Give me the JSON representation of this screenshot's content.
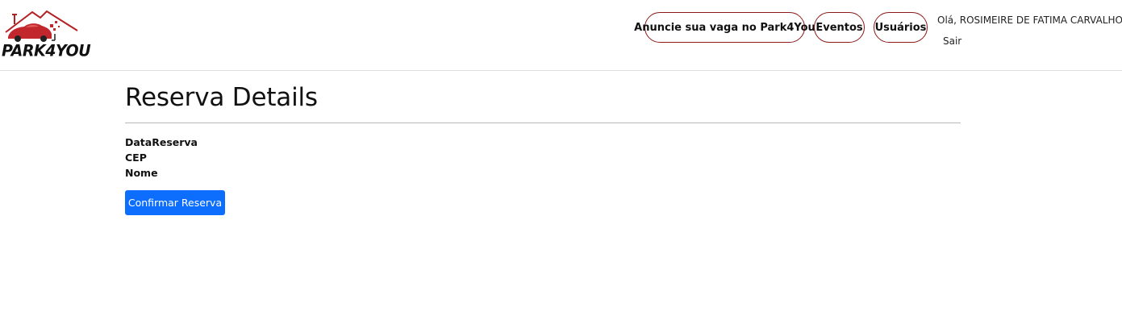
{
  "brand": {
    "name": "PARK4YOU",
    "colors": {
      "roof": "#b22222",
      "car": "#c1272d",
      "text": "#111111"
    }
  },
  "nav": {
    "items": [
      {
        "label": "Anuncie sua vaga no Park4You"
      },
      {
        "label": "Eventos"
      },
      {
        "label": "Usuários"
      }
    ],
    "pill_border_color": "#8b1a1a",
    "greeting": "Olá, ROSIMEIRE DE FATIMA CARVALHO",
    "logout": "Sair"
  },
  "main": {
    "title": "Reserva Details",
    "fields": [
      {
        "label": "DataReserva"
      },
      {
        "label": "CEP"
      },
      {
        "label": "Nome"
      }
    ],
    "confirm_button": {
      "label": "Confirmar Reserva",
      "color": "#0d6efd"
    }
  }
}
